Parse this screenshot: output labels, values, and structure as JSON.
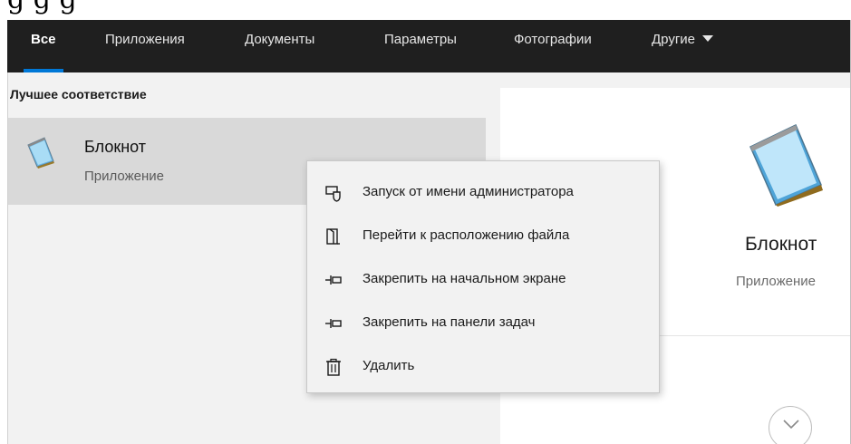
{
  "top_cut_text": "g                          g                     g",
  "tabs": [
    {
      "label": "Все",
      "active": true
    },
    {
      "label": "Приложения"
    },
    {
      "label": "Документы"
    },
    {
      "label": "Параметры"
    },
    {
      "label": "Фотографии"
    },
    {
      "label": "Другие",
      "has_dropdown": true
    }
  ],
  "left": {
    "section_title": "Лучшее соответствие",
    "best_match": {
      "name": "Блокнот",
      "type": "Приложение",
      "icon": "notepad-icon"
    }
  },
  "preview": {
    "name": "Блокнот",
    "type": "Приложение",
    "icon": "notepad-icon",
    "expand_icon": "chevron-down-icon"
  },
  "context_menu": {
    "items": [
      {
        "label": "Запуск от имени администратора",
        "icon": "run-as-admin-icon"
      },
      {
        "label": "Перейти к расположению файла",
        "icon": "open-file-location-icon"
      },
      {
        "label": "Закрепить на начальном экране",
        "icon": "pin-icon"
      },
      {
        "label": "Закрепить на панели задач",
        "icon": "pin-icon"
      },
      {
        "label": "Удалить",
        "icon": "trash-icon"
      }
    ]
  },
  "colors": {
    "tabbar_bg": "#1f1f1f",
    "active_underline": "#0078d7",
    "panel_bg": "#f2f2f2",
    "selected_item_bg": "#d9d9d9"
  }
}
